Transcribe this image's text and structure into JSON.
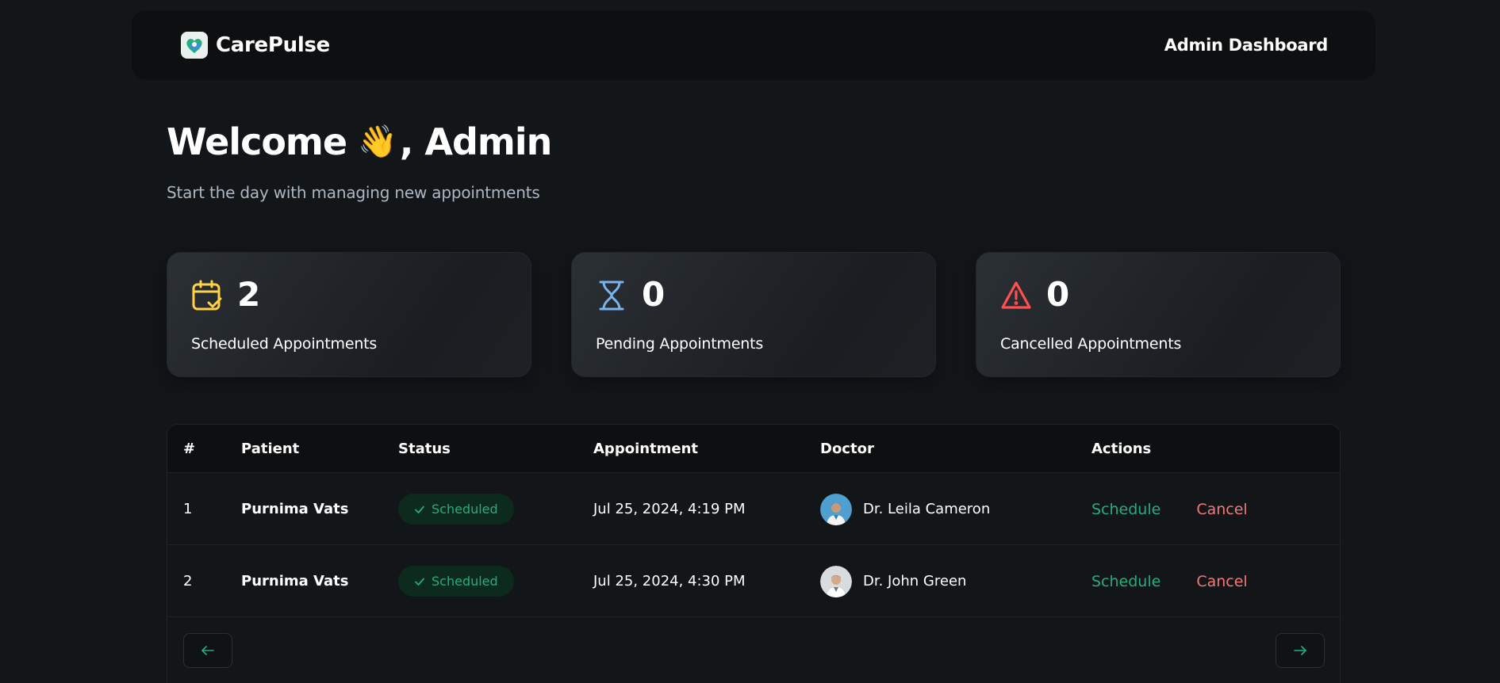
{
  "header": {
    "brand": "CarePulse",
    "title": "Admin Dashboard"
  },
  "welcome": {
    "greeting_prefix": "Welcome",
    "emoji": "👋",
    "greeting_suffix": ", Admin",
    "subtitle": "Start the day with managing new appointments"
  },
  "stats": [
    {
      "count": "2",
      "label": "Scheduled Appointments",
      "icon": "calendar-check-icon",
      "color": "#ffd147"
    },
    {
      "count": "0",
      "label": "Pending Appointments",
      "icon": "hourglass-icon",
      "color": "#79b5ec"
    },
    {
      "count": "0",
      "label": "Cancelled Appointments",
      "icon": "alert-triangle-icon",
      "color": "#ff4f4e"
    }
  ],
  "table": {
    "headers": [
      "#",
      "Patient",
      "Status",
      "Appointment",
      "Doctor",
      "Actions"
    ],
    "rows": [
      {
        "num": "1",
        "patient": "Purnima Vats",
        "status": "Scheduled",
        "appointment": "Jul 25, 2024, 4:19 PM",
        "doctor": "Dr. Leila Cameron",
        "schedule": "Schedule",
        "cancel": "Cancel"
      },
      {
        "num": "2",
        "patient": "Purnima Vats",
        "status": "Scheduled",
        "appointment": "Jul 25, 2024, 4:30 PM",
        "doctor": "Dr. John Green",
        "schedule": "Schedule",
        "cancel": "Cancel"
      }
    ]
  },
  "colors": {
    "background": "#131619",
    "green": "#24ae7c",
    "red": "#f37877",
    "yellow": "#ffd147",
    "blue": "#79b5ec"
  }
}
